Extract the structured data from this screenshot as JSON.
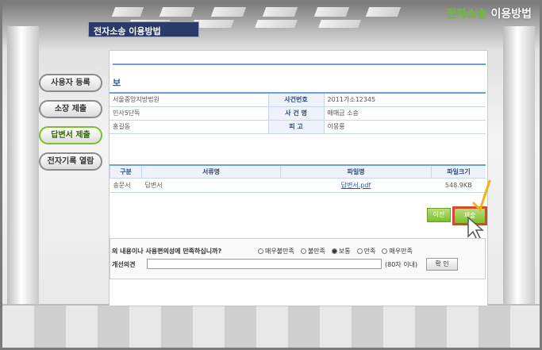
{
  "header": {
    "title_part1": "전자소송",
    "title_part2": "이용방법"
  },
  "tab_label": "전자소송 이용방법",
  "sidebar": {
    "items": [
      {
        "label": "사용자 등록"
      },
      {
        "label": "소장 제출"
      },
      {
        "label": "답변서 제출"
      },
      {
        "label": "전자기록 열람"
      }
    ]
  },
  "case_info": {
    "section_title": "보",
    "rows": [
      {
        "v1": "서울중앙지방법원",
        "k": "사건번호",
        "v2": "2011가소12345"
      },
      {
        "v1": "민사5단독",
        "k": "사 건 명",
        "v2": "매매금 소송"
      },
      {
        "v1": "홍길동",
        "k": "피  고",
        "v2": "이몽룡"
      }
    ]
  },
  "files": {
    "headers": [
      "구분",
      "서류명",
      "파일명",
      "파일크기"
    ],
    "rows": [
      {
        "type": "송문서",
        "name": "답변서",
        "filename": "답변서.pdf",
        "size": "548.9KB"
      }
    ]
  },
  "buttons": {
    "prev": "이전",
    "submit": "제출"
  },
  "survey": {
    "question": "의 내용이나 사용편의성에 만족하십니까?",
    "options": [
      {
        "label": "매우불만족"
      },
      {
        "label": "불만족"
      },
      {
        "label": "보통"
      },
      {
        "label": "만족"
      },
      {
        "label": "매우만족"
      }
    ],
    "selected": "보통",
    "opinion_label": "개선의견",
    "opinion_value": "",
    "limit_note": "(80자 이내)",
    "confirm": "확 인"
  },
  "colors": {
    "accent_green": "#6bbf2b",
    "header_blue": "#2a3b6a",
    "highlight_red": "#d64a2a"
  }
}
